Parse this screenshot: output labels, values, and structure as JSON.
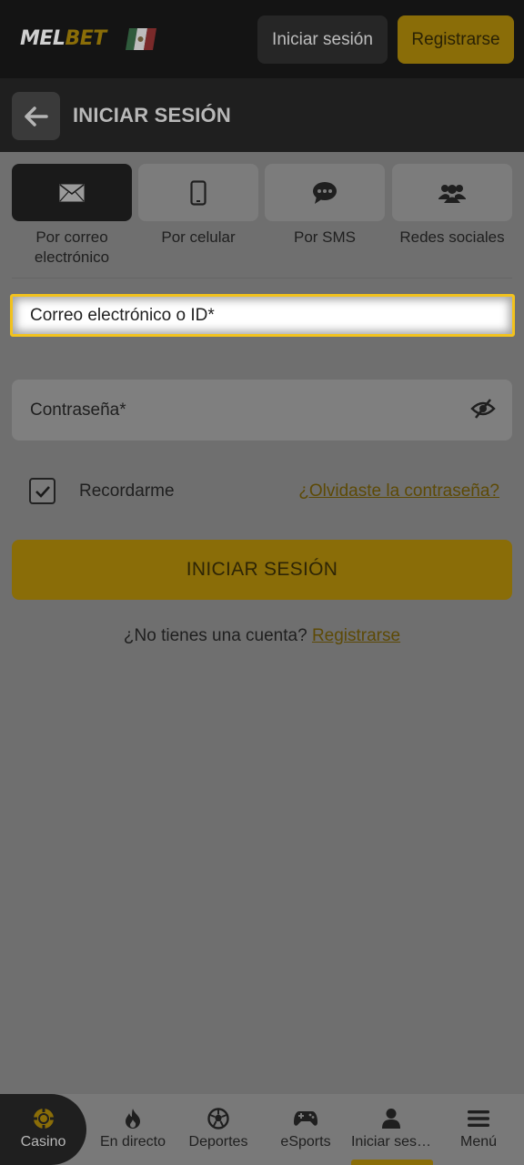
{
  "header": {
    "logo_mel": "MEL",
    "logo_bet": "BET",
    "login_label": "Iniciar sesión",
    "register_label": "Registrarse"
  },
  "title_bar": {
    "title": "INICIAR SESIÓN"
  },
  "login_methods": [
    {
      "label": "Por correo electrónico",
      "icon": "envelope-icon",
      "active": true
    },
    {
      "label": "Por celular",
      "icon": "phone-icon",
      "active": false
    },
    {
      "label": "Por SMS",
      "icon": "chat-bubble-icon",
      "active": false
    },
    {
      "label": "Redes sociales",
      "icon": "users-icon",
      "active": false
    }
  ],
  "form": {
    "email_placeholder": "Correo electrónico o ID*",
    "password_placeholder": "Contraseña*",
    "remember_label": "Recordarme",
    "remember_checked": true,
    "forgot_link": "¿Olvidaste la contraseña?",
    "submit_label": "INICIAR SESIÓN",
    "no_account_text": "¿No tienes una cuenta?",
    "register_link": "Registrarse"
  },
  "bottom_nav": [
    {
      "label": "Casino",
      "icon": "casino-chip-icon",
      "active": false
    },
    {
      "label": "En directo",
      "icon": "flame-icon",
      "active": false
    },
    {
      "label": "Deportes",
      "icon": "soccer-ball-icon",
      "active": false
    },
    {
      "label": "eSports",
      "icon": "gamepad-icon",
      "active": false
    },
    {
      "label": "Iniciar ses…",
      "icon": "user-icon",
      "active": true
    },
    {
      "label": "Menú",
      "icon": "hamburger-menu-icon",
      "active": false
    }
  ],
  "colors": {
    "accent": "#f2c21d",
    "accent_dimmed": "#8a6d08",
    "overlay_background": "#6f6f6f",
    "header_background": "#141414"
  }
}
